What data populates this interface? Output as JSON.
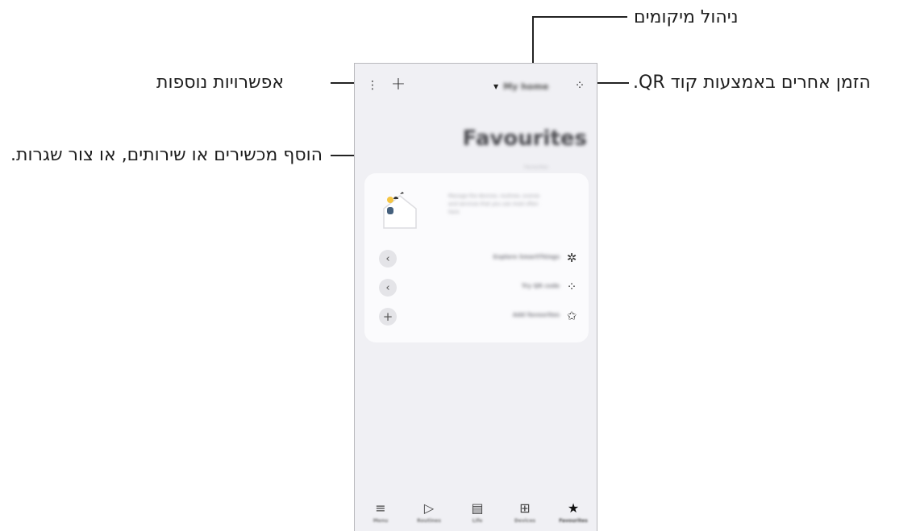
{
  "callouts": {
    "manage_locations": "ניהול מיקומים",
    "qr_invite": "הזמן אחרים באמצעות קוד QR.",
    "more_options": "אפשרויות נוספות",
    "add_devices": "הוסף מכשירים או שירותים, או צור שגרות."
  },
  "screen": {
    "location_name": "My home",
    "title": "Favourites",
    "subtitle": "Favourites",
    "card_text": "Manage the devices, routines, scenes and services that you use most often here",
    "rows": [
      {
        "label": "Explore SmartThings",
        "icon": "✲",
        "action": "‹"
      },
      {
        "label": "Try QR code",
        "icon": "⁘",
        "action": "‹"
      },
      {
        "label": "Add favourites",
        "icon": "✩",
        "action": "+"
      }
    ],
    "nav_tabs": [
      {
        "label": "Menu",
        "icon": "≡"
      },
      {
        "label": "Routines",
        "icon": "▷"
      },
      {
        "label": "Life",
        "icon": "▤"
      },
      {
        "label": "Devices",
        "icon": "⊞"
      },
      {
        "label": "Favourites",
        "icon": "★"
      }
    ]
  }
}
